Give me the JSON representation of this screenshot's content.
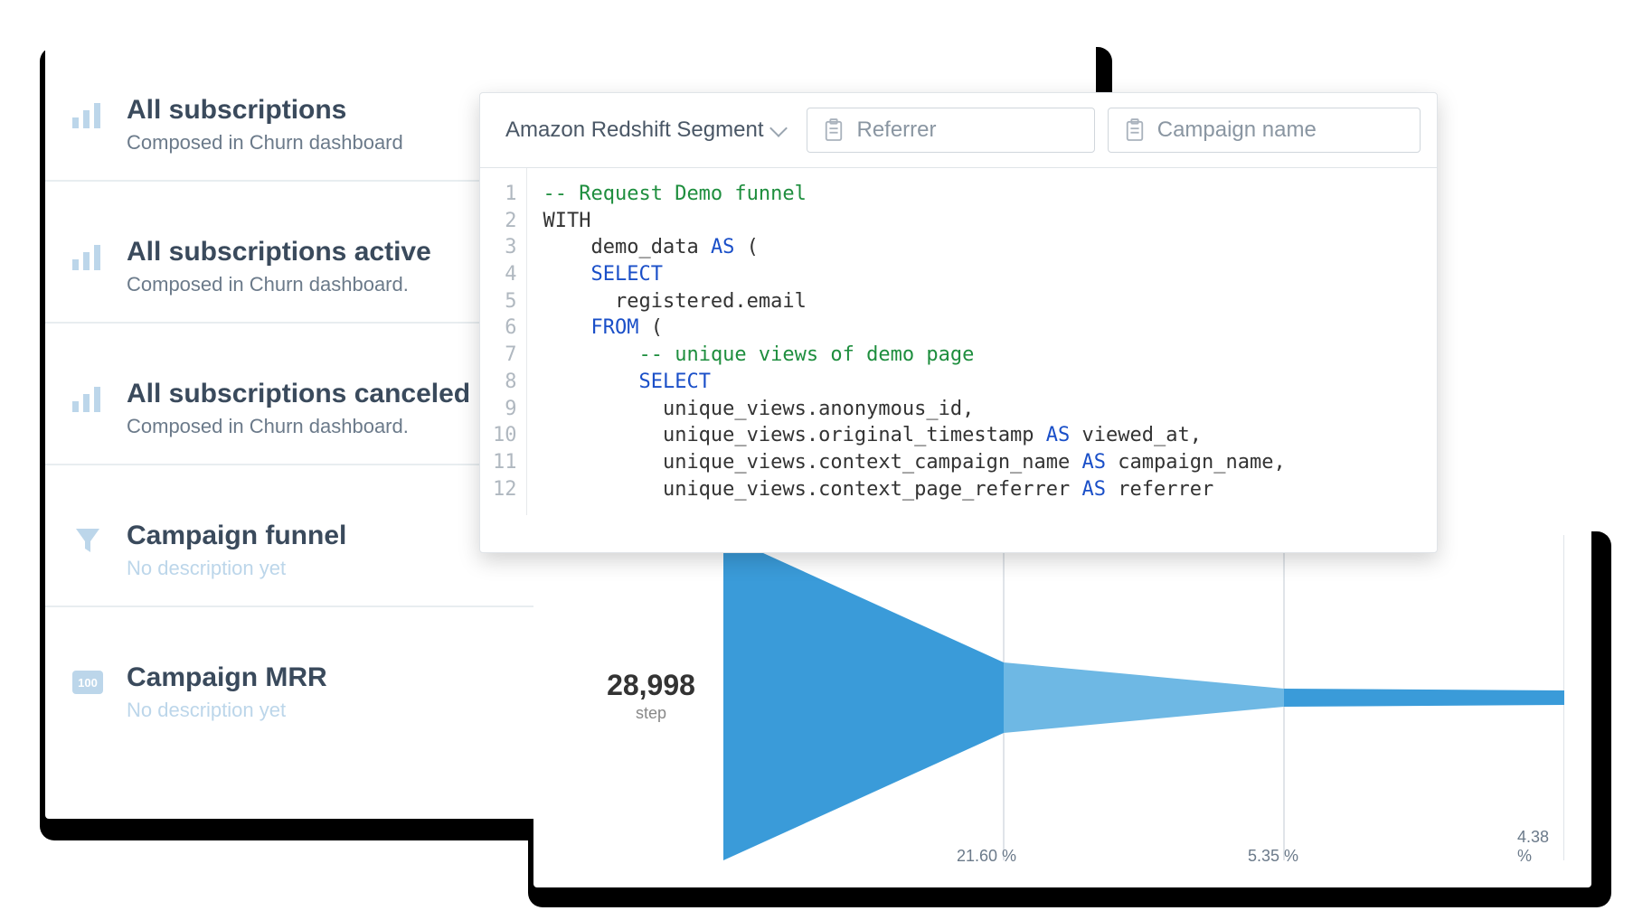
{
  "colors": {
    "accent": "#3a9bd9",
    "accent_light": "#6eb8e4",
    "muted": "#bcd6ea"
  },
  "sidebar": {
    "items": [
      {
        "title": "All subscriptions",
        "sub": "Composed in Churn dashboard",
        "icon": "bar"
      },
      {
        "title": "All subscriptions active",
        "sub": "Composed in Churn dashboard.",
        "icon": "bar"
      },
      {
        "title": "All subscriptions canceled",
        "sub": "Composed in Churn dashboard.",
        "icon": "bar"
      },
      {
        "title": "Campaign funnel",
        "sub": "No description yet",
        "icon": "funnel"
      },
      {
        "title": "Campaign MRR",
        "sub": "No description yet",
        "icon": "number"
      }
    ]
  },
  "editor": {
    "segment_label": "Amazon Redshift Segment",
    "referrer_placeholder": "Referrer",
    "campaign_placeholder": "Campaign name",
    "code_lines": {
      "l1": "-- Request Demo funnel",
      "l2": "WITH",
      "l3_indent": "    demo_data ",
      "l3_kw": "AS",
      "l3_tail": " (",
      "l4_indent": "    ",
      "l4_kw": "SELECT",
      "l5": "      registered.email",
      "l6_indent": "    ",
      "l6_kw": "FROM",
      "l6_tail": " (",
      "l7_indent": "        ",
      "l7_cm": "-- unique views of demo page",
      "l8_indent": "        ",
      "l8_kw": "SELECT",
      "l9": "          unique_views.anonymous_id,",
      "l10_a": "          unique_views.original_timestamp ",
      "l10_kw": "AS",
      "l10_b": " viewed_at,",
      "l11_a": "          unique_views.context_campaign_name ",
      "l11_kw": "AS",
      "l11_b": " campaign_name,",
      "l12_a": "          unique_views.context_page_referrer ",
      "l12_kw": "AS",
      "l12_b": " referrer"
    },
    "gutter": [
      "1",
      "2",
      "3",
      "4",
      "5",
      "6",
      "7",
      "8",
      "9",
      "10",
      "11",
      "12"
    ]
  },
  "chart_data": {
    "type": "funnel",
    "title": "",
    "steps": [
      {
        "label": "step",
        "value": 28998,
        "pct": 100
      },
      {
        "label": "",
        "value": 6264,
        "pct": 21.6
      },
      {
        "label": "",
        "value": 1551,
        "pct": 5.35
      },
      {
        "label": "",
        "value": 1270,
        "pct": 4.38
      }
    ],
    "value_display": "28,998",
    "step_label": "step",
    "pct_labels": [
      "21.60 %",
      "5.35 %",
      "4.38 %"
    ]
  },
  "number_badge": "100"
}
